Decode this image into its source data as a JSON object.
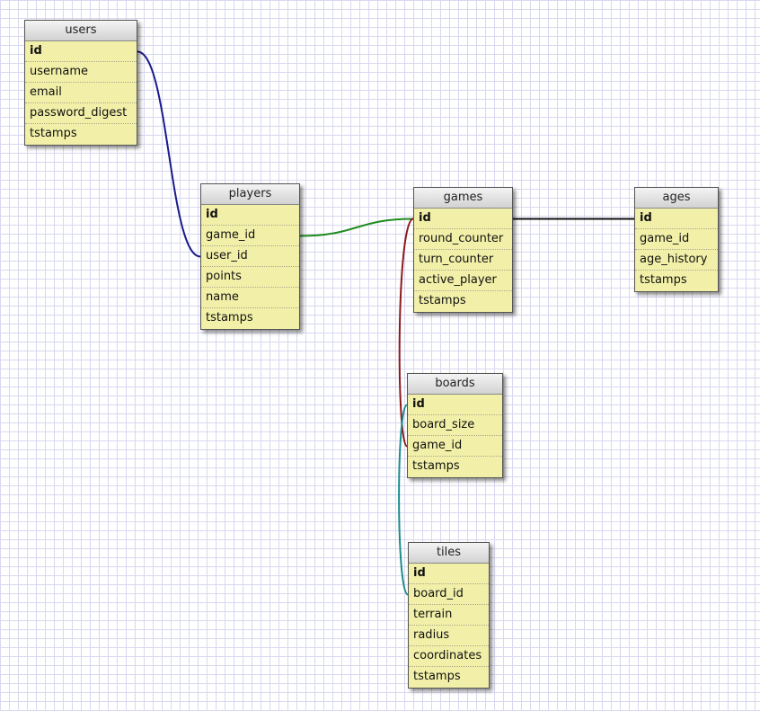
{
  "tables": [
    {
      "id": "users",
      "name": "users",
      "fields": [
        {
          "label": "id",
          "pk": true
        },
        {
          "label": "username"
        },
        {
          "label": "email"
        },
        {
          "label": "password_digest"
        },
        {
          "label": "tstamps"
        }
      ]
    },
    {
      "id": "players",
      "name": "players",
      "fields": [
        {
          "label": "id",
          "pk": true
        },
        {
          "label": "game_id"
        },
        {
          "label": "user_id"
        },
        {
          "label": "points"
        },
        {
          "label": "name"
        },
        {
          "label": "tstamps"
        }
      ]
    },
    {
      "id": "games",
      "name": "games",
      "fields": [
        {
          "label": "id",
          "pk": true
        },
        {
          "label": "round_counter"
        },
        {
          "label": "turn_counter"
        },
        {
          "label": "active_player"
        },
        {
          "label": "tstamps"
        }
      ]
    },
    {
      "id": "ages",
      "name": "ages",
      "fields": [
        {
          "label": "id",
          "pk": true
        },
        {
          "label": "game_id"
        },
        {
          "label": "age_history"
        },
        {
          "label": "tstamps"
        }
      ]
    },
    {
      "id": "boards",
      "name": "boards",
      "fields": [
        {
          "label": "id",
          "pk": true
        },
        {
          "label": "board_size"
        },
        {
          "label": "game_id"
        },
        {
          "label": "tstamps"
        }
      ]
    },
    {
      "id": "tiles",
      "name": "tiles",
      "fields": [
        {
          "label": "id",
          "pk": true
        },
        {
          "label": "board_id"
        },
        {
          "label": "terrain"
        },
        {
          "label": "radius"
        },
        {
          "label": "coordinates"
        },
        {
          "label": "tstamps"
        }
      ]
    }
  ],
  "relations": [
    {
      "from": "users.id",
      "to": "players.user_id",
      "color": "#1a1a8c"
    },
    {
      "from": "players.game_id",
      "to": "games.id",
      "color": "#1e8c1e"
    },
    {
      "from": "games.id",
      "to": "ages.id",
      "color": "#111111"
    },
    {
      "from": "games.id",
      "to": "boards.game_id",
      "color": "#8c1a1a"
    },
    {
      "from": "boards.id",
      "to": "tiles.board_id",
      "color": "#1a8c8c"
    }
  ]
}
